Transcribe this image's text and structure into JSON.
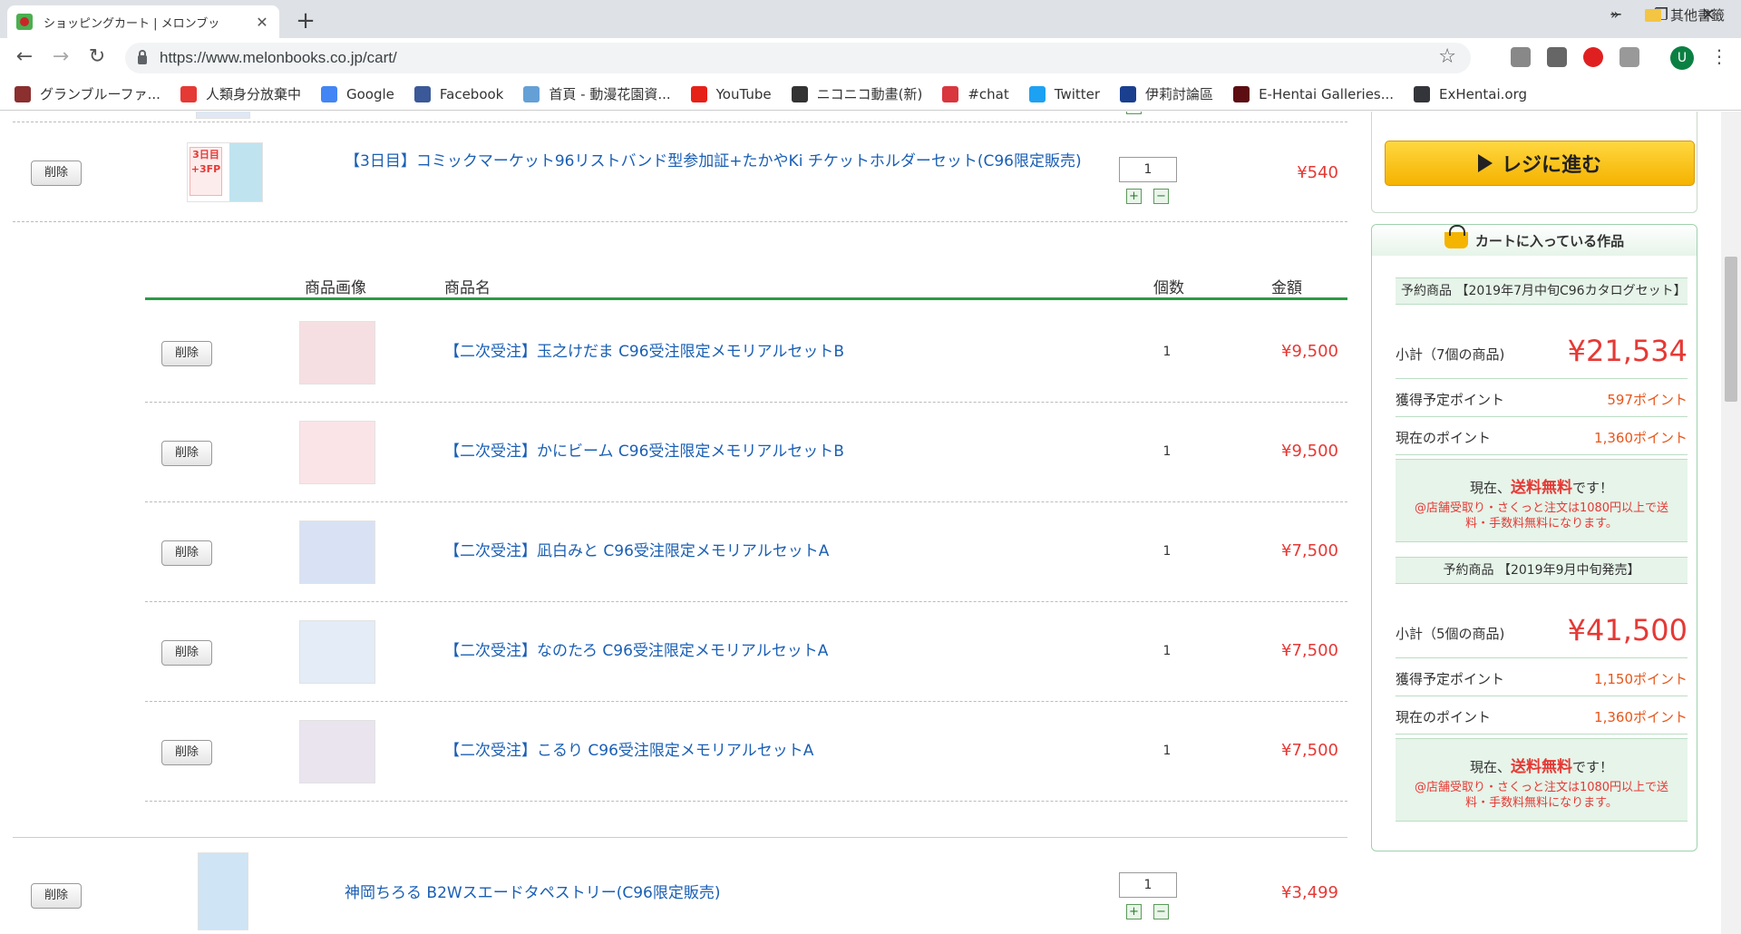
{
  "browser": {
    "tab_title": "ショッピングカート | メロンブッ",
    "tab_close": "✕",
    "new_tab": "+",
    "url": "https://www.melonbooks.co.jp/cart/",
    "avatar_letter": "U",
    "window_buttons": [
      "─",
      "❐",
      "✕"
    ],
    "nav": {
      "back": "←",
      "forward": "→",
      "reload": "↻"
    },
    "bookmarks": [
      {
        "label": "グランブルーファ...",
        "icon": "granblue-icon",
        "color": "#8b2f2f"
      },
      {
        "label": "人類身分放棄中",
        "icon": "blog-icon",
        "color": "#e53935"
      },
      {
        "label": "Google",
        "icon": "google-icon",
        "color": "#4285f4"
      },
      {
        "label": "Facebook",
        "icon": "facebook-icon",
        "color": "#3b5998"
      },
      {
        "label": "首頁 - 動漫花園資...",
        "icon": "dmhy-icon",
        "color": "#64a0d6"
      },
      {
        "label": "YouTube",
        "icon": "youtube-icon",
        "color": "#e62117"
      },
      {
        "label": "ニコニコ動畫(新)",
        "icon": "niconico-icon",
        "color": "#333333"
      },
      {
        "label": "#chat",
        "icon": "chat-icon",
        "color": "#d9363e"
      },
      {
        "label": "Twitter",
        "icon": "twitter-icon",
        "color": "#1da1f2"
      },
      {
        "label": "伊莉討論區",
        "icon": "eyny-icon",
        "color": "#1a3f8f"
      },
      {
        "label": "E-Hentai Galleries...",
        "icon": "ehentai-icon",
        "color": "#5c0d12"
      },
      {
        "label": "ExHentai.org",
        "icon": "exhentai-icon",
        "color": "#34353b"
      }
    ],
    "bookmarks_more": "»",
    "other_bookmarks": "其他書籤"
  },
  "cart": {
    "delete_label": "削除",
    "top_item": {
      "name": "【3日目】コミックマーケット96リストバンド型参加証+たかやKi チケットホルダーセット(C96限定販売)",
      "qty": "1",
      "price": "¥540"
    },
    "set_header": {
      "image": "商品画像",
      "name": "商品名",
      "qty": "個数",
      "price": "金額"
    },
    "set_items": [
      {
        "name": "【二次受注】玉之けだま C96受注限定メモリアルセットB",
        "qty": "1",
        "price": "¥9,500"
      },
      {
        "name": "【二次受注】かにビーム C96受注限定メモリアルセットB",
        "qty": "1",
        "price": "¥9,500"
      },
      {
        "name": "【二次受注】凪白みと C96受注限定メモリアルセットA",
        "qty": "1",
        "price": "¥7,500"
      },
      {
        "name": "【二次受注】なのたろ C96受注限定メモリアルセットA",
        "qty": "1",
        "price": "¥7,500"
      },
      {
        "name": "【二次受注】こるり C96受注限定メモリアルセットA",
        "qty": "1",
        "price": "¥7,500"
      }
    ],
    "bottom_item": {
      "name": "神岡ちろる B2Wスエードタペストリー(C96限定販売)",
      "qty": "1",
      "price": "¥3,499"
    },
    "stepper_plus": "+",
    "stepper_minus": "−"
  },
  "sidebar": {
    "checkout_label": "レジに進む",
    "summary_title": "カートに入っている作品",
    "groups": [
      {
        "title": "予約商品 【2019年7月中旬C96カタログセット】",
        "subtotal_label": "小計（7個の商品)",
        "subtotal": "¥21,534",
        "points_label": "獲得予定ポイント",
        "points": "597ポイント",
        "current_label": "現在のポイント",
        "current": "1,360ポイント",
        "notice_pre": "現在、",
        "notice_em": "送料無料",
        "notice_post": "です！",
        "notice_sub": "@店舗受取り・さくっと注文は1080円以上で送料・手数料無料になります。"
      },
      {
        "title": "予約商品 【2019年9月中旬発売】",
        "subtotal_label": "小計（5個の商品)",
        "subtotal": "¥41,500",
        "points_label": "獲得予定ポイント",
        "points": "1,150ポイント",
        "current_label": "現在のポイント",
        "current": "1,360ポイント",
        "notice_pre": "現在、",
        "notice_em": "送料無料",
        "notice_post": "です！",
        "notice_sub": "@店舗受取り・さくっと注文は1080円以上で送料・手数料無料になります。"
      }
    ]
  }
}
